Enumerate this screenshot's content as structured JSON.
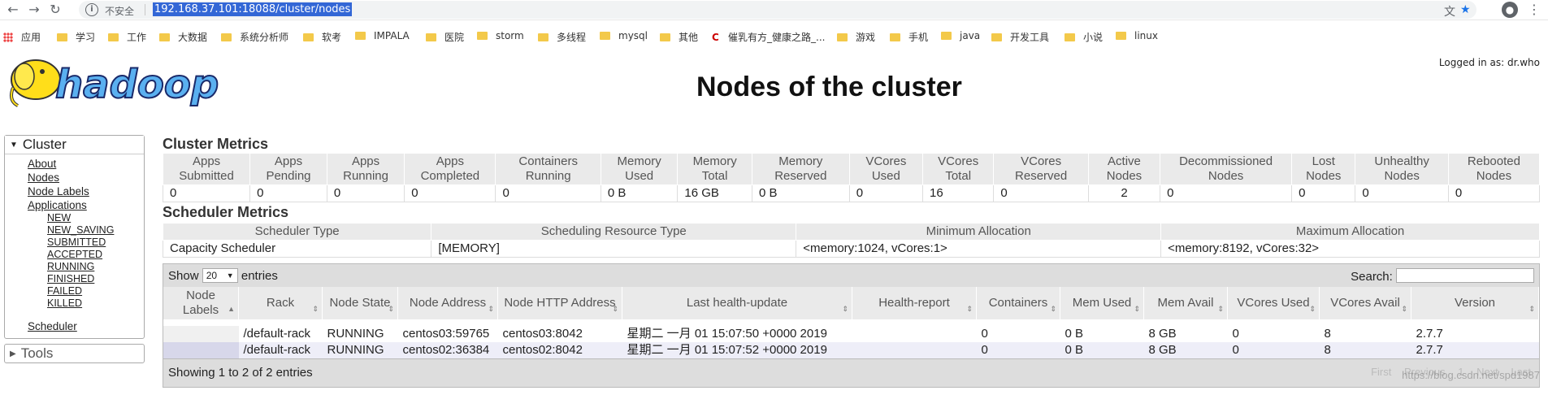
{
  "browser": {
    "insecure_label": "不安全",
    "url": "192.168.37.101:18088/cluster/nodes"
  },
  "bookmarks": [
    {
      "label": "应用",
      "type": "apps"
    },
    {
      "label": "学习",
      "type": "folder"
    },
    {
      "label": "工作",
      "type": "folder"
    },
    {
      "label": "大数据",
      "type": "folder"
    },
    {
      "label": "系统分析师",
      "type": "folder"
    },
    {
      "label": "软考",
      "type": "folder"
    },
    {
      "label": "IMPALA",
      "type": "folder"
    },
    {
      "label": "医院",
      "type": "folder"
    },
    {
      "label": "storm",
      "type": "folder"
    },
    {
      "label": "多线程",
      "type": "folder"
    },
    {
      "label": "mysql",
      "type": "folder"
    },
    {
      "label": "其他",
      "type": "folder"
    },
    {
      "label": "催乳有方_健康之路_...",
      "type": "site"
    },
    {
      "label": "游戏",
      "type": "folder"
    },
    {
      "label": "手机",
      "type": "folder"
    },
    {
      "label": "java",
      "type": "folder"
    },
    {
      "label": "开发工具",
      "type": "folder"
    },
    {
      "label": "小说",
      "type": "folder"
    },
    {
      "label": "linux",
      "type": "folder"
    }
  ],
  "header": {
    "logo_text": "hadoop",
    "title": "Nodes of the cluster",
    "logged_in": "Logged in as: dr.who"
  },
  "sidebar": {
    "cluster_label": "Cluster",
    "links": [
      "About",
      "Nodes",
      "Node Labels",
      "Applications"
    ],
    "app_states": [
      "NEW",
      "NEW_SAVING",
      "SUBMITTED",
      "ACCEPTED",
      "RUNNING",
      "FINISHED",
      "FAILED",
      "KILLED"
    ],
    "scheduler_label": "Scheduler",
    "tools_label": "Tools"
  },
  "cluster_metrics": {
    "title": "Cluster Metrics",
    "headers": [
      "Apps Submitted",
      "Apps Pending",
      "Apps Running",
      "Apps Completed",
      "Containers Running",
      "Memory Used",
      "Memory Total",
      "Memory Reserved",
      "VCores Used",
      "VCores Total",
      "VCores Reserved",
      "Active Nodes",
      "Decommissioned Nodes",
      "Lost Nodes",
      "Unhealthy Nodes",
      "Rebooted Nodes"
    ],
    "values": [
      "0",
      "0",
      "0",
      "0",
      "0",
      "0 B",
      "16 GB",
      "0 B",
      "0",
      "16",
      "0",
      "2",
      "0",
      "0",
      "0",
      "0"
    ]
  },
  "scheduler_metrics": {
    "title": "Scheduler Metrics",
    "headers": [
      "Scheduler Type",
      "Scheduling Resource Type",
      "Minimum Allocation",
      "Maximum Allocation"
    ],
    "values": [
      "Capacity Scheduler",
      "[MEMORY]",
      "<memory:1024, vCores:1>",
      "<memory:8192, vCores:32>"
    ]
  },
  "nodes_table": {
    "show_label": "Show",
    "page_size": "20",
    "entries_label": "entries",
    "search_label": "Search:",
    "headers": [
      "Node Labels",
      "Rack",
      "Node State",
      "Node Address",
      "Node HTTP Address",
      "Last health-update",
      "Health-report",
      "Containers",
      "Mem Used",
      "Mem Avail",
      "VCores Used",
      "VCores Avail",
      "Version"
    ],
    "rows": [
      [
        "",
        "/default-rack",
        "RUNNING",
        "centos03:59765",
        "centos03:8042",
        "星期二 一月 01 15:07:50 +0000 2019",
        "",
        "0",
        "0 B",
        "8 GB",
        "0",
        "8",
        "2.7.7"
      ],
      [
        "",
        "/default-rack",
        "RUNNING",
        "centos02:36384",
        "centos02:8042",
        "星期二 一月 01 15:07:52 +0000 2019",
        "",
        "0",
        "0 B",
        "8 GB",
        "0",
        "8",
        "2.7.7"
      ]
    ],
    "info": "Showing 1 to 2 of 2 entries",
    "pager": [
      "First",
      "Previous",
      "1",
      "Next",
      "Last"
    ]
  },
  "watermark": "https://blog.csdn.net/spd1987"
}
